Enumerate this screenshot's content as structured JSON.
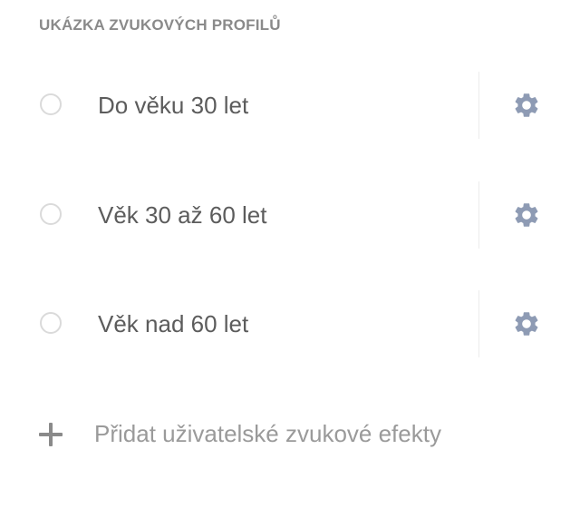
{
  "section": {
    "title": "UKÁZKA ZVUKOVÝCH PROFILŮ"
  },
  "profiles": [
    {
      "label": "Do věku 30 let",
      "selected": false
    },
    {
      "label": "Věk 30 až 60 let",
      "selected": false
    },
    {
      "label": "Věk nad 60 let",
      "selected": false
    }
  ],
  "add_custom": {
    "label": "Přidat uživatelské zvukové efekty",
    "icon": "plus-icon"
  },
  "icons": {
    "settings": "gear-icon",
    "radio": "radio-unselected"
  },
  "colors": {
    "header_text": "#8a8a8a",
    "label_text": "#5c5c5c",
    "add_text": "#9a9a9a",
    "gear": "#8e9bb4",
    "radio_border": "#dadada"
  }
}
